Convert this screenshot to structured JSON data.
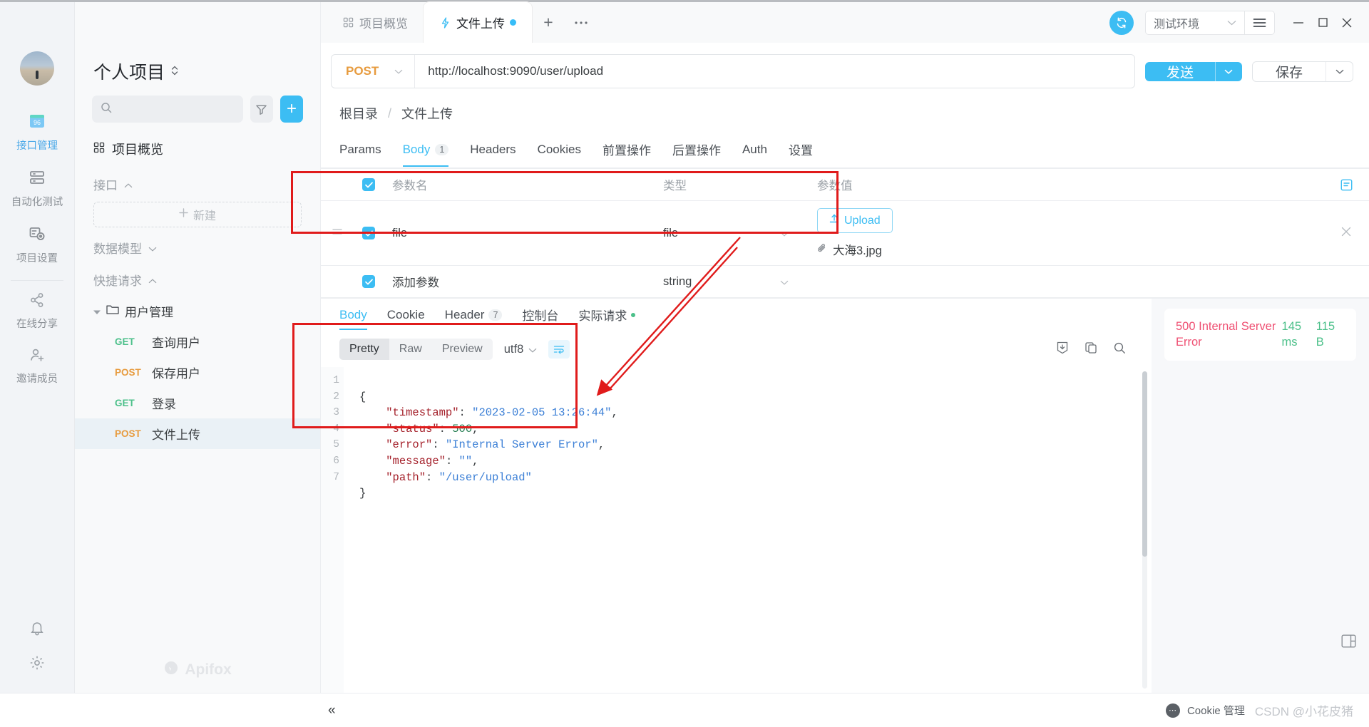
{
  "window": {
    "minimize": "–",
    "maximize": "□",
    "close": "✕"
  },
  "topbar": {
    "sync_icon": "sync-icon",
    "environment": "测试环境",
    "menu_icon": "hamburger-menu-icon",
    "tabs": [
      {
        "label": "项目概览",
        "icon": "grid-icon",
        "active": false,
        "dirty": false
      },
      {
        "label": "文件上传",
        "icon": "lightning-icon",
        "active": true,
        "dirty": true
      }
    ],
    "new_tab": "+",
    "more_tabs": "···"
  },
  "rail": {
    "items": [
      {
        "label": "接口管理",
        "icon": "api-management-icon",
        "active": true
      },
      {
        "label": "自动化测试",
        "icon": "automation-test-icon",
        "active": false
      },
      {
        "label": "项目设置",
        "icon": "project-settings-icon",
        "active": false
      },
      {
        "label": "在线分享",
        "icon": "share-icon",
        "active": false
      },
      {
        "label": "邀请成员",
        "icon": "invite-member-icon",
        "active": false
      }
    ],
    "bottom": [
      {
        "icon": "bell-icon"
      },
      {
        "icon": "gear-icon"
      }
    ]
  },
  "sidebar": {
    "project_title": "个人项目",
    "search_placeholder": "",
    "search_value": "",
    "filter_icon": "filter-icon",
    "add_label": "+",
    "overview_label": "项目概览",
    "groups": [
      {
        "label": "接口",
        "expanded": true
      },
      {
        "label": "数据模型",
        "expanded": false
      },
      {
        "label": "快捷请求",
        "expanded": true
      }
    ],
    "new_item_label": "新建",
    "folder": "用户管理",
    "apis": [
      {
        "verb": "GET",
        "name": "查询用户",
        "active": false
      },
      {
        "verb": "POST",
        "name": "保存用户",
        "active": false
      },
      {
        "verb": "GET",
        "name": "登录",
        "active": false
      },
      {
        "verb": "POST",
        "name": "文件上传",
        "active": true
      }
    ],
    "brand": "Apifox"
  },
  "request": {
    "method": "POST",
    "url": "http://localhost:9090/user/upload",
    "send_label": "发送",
    "save_label": "保存",
    "breadcrumb": [
      "根目录",
      "文件上传"
    ],
    "breadcrumb_sep": "/",
    "tabs": [
      {
        "label": "Params",
        "badge": "",
        "active": false
      },
      {
        "label": "Body",
        "badge": "1",
        "active": true
      },
      {
        "label": "Headers",
        "badge": "",
        "active": false
      },
      {
        "label": "Cookies",
        "badge": "",
        "active": false
      },
      {
        "label": "前置操作",
        "badge": "",
        "active": false
      },
      {
        "label": "后置操作",
        "badge": "",
        "active": false
      },
      {
        "label": "Auth",
        "badge": "",
        "active": false
      },
      {
        "label": "设置",
        "badge": "",
        "active": false
      }
    ],
    "table": {
      "headers": [
        "参数名",
        "类型",
        "参数值"
      ],
      "rows": [
        {
          "checked": true,
          "name": "file",
          "name_placeholder": "",
          "type": "file",
          "upload_label": "Upload",
          "file_name": "大海3.jpg",
          "is_placeholder_row": false
        },
        {
          "checked": true,
          "name": "",
          "name_placeholder": "添加参数",
          "type": "string",
          "upload_label": "",
          "file_name": "",
          "is_placeholder_row": true
        }
      ]
    }
  },
  "response": {
    "tabs": [
      {
        "label": "Body",
        "badge": "",
        "dot": false,
        "active": true
      },
      {
        "label": "Cookie",
        "badge": "",
        "dot": false,
        "active": false
      },
      {
        "label": "Header",
        "badge": "7",
        "dot": false,
        "active": false
      },
      {
        "label": "控制台",
        "badge": "",
        "dot": false,
        "active": false
      },
      {
        "label": "实际请求",
        "badge": "",
        "dot": true,
        "active": false
      }
    ],
    "view_modes": [
      {
        "label": "Pretty",
        "active": true
      },
      {
        "label": "Raw",
        "active": false
      },
      {
        "label": "Preview",
        "active": false
      }
    ],
    "encoding": "utf8",
    "wrap_icon": "text-wrap-icon",
    "actions": [
      "download-icon",
      "copy-icon",
      "search-icon"
    ],
    "line_numbers": [
      "1",
      "2",
      "3",
      "4",
      "5",
      "6",
      "7"
    ],
    "body_json": {
      "timestamp": "2023-02-05 13:26:44",
      "status": "500",
      "error": "Internal Server Error",
      "message": "",
      "path": "/user/upload"
    },
    "status": {
      "name": "500 Internal Server Error",
      "time": "145 ms",
      "time_value": "145",
      "time_unit": "ms",
      "size_value": "115",
      "size_unit": "B"
    }
  },
  "bottombar": {
    "collapse": "«",
    "cookie_label": "Cookie 管理",
    "watermark": "CSDN @小花皮猪",
    "layout_icon": "layout-icon"
  },
  "colors": {
    "accent": "#3cbdf3",
    "get": "#4cc08a",
    "post": "#e79b3e",
    "error": "#ef4f72",
    "success": "#4cc08a",
    "annotation": "#e01b1b"
  }
}
